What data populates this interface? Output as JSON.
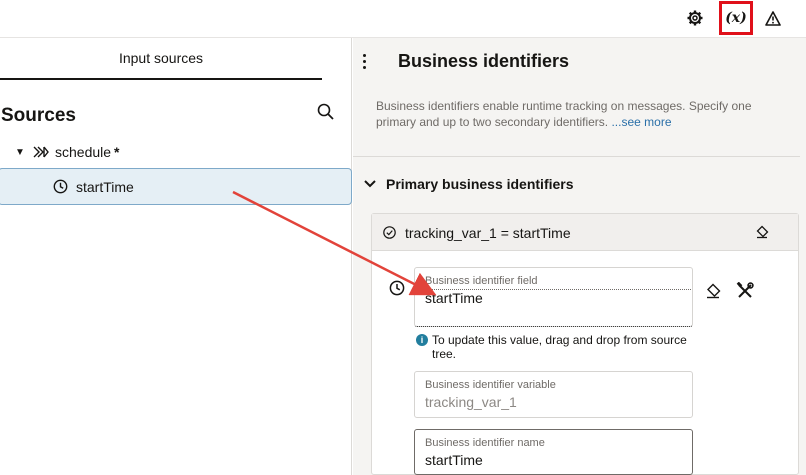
{
  "toolbar": {
    "variables_glyph": "(x)",
    "icons": [
      "gear-icon",
      "variables-icon",
      "warning-icon"
    ],
    "highlight_color": "#e0101a"
  },
  "left_panel": {
    "tab_label": "Input sources",
    "title": "Sources",
    "tree": {
      "root": {
        "label": "schedule",
        "modifier": "*"
      },
      "child": {
        "label": "startTime"
      }
    }
  },
  "right_panel": {
    "title": "Business identifiers",
    "description": "Business identifiers enable runtime tracking on messages. Specify one primary and up to two secondary identifiers.",
    "see_more": "...see more",
    "section_title": "Primary business identifiers",
    "card": {
      "header_label": "tracking_var_1 = startTime",
      "field1": {
        "label": "Business identifier field",
        "value": "startTime"
      },
      "info_text": "To update this value, drag and drop from source tree.",
      "info_badge": "i",
      "field2": {
        "label": "Business identifier variable",
        "value": "tracking_var_1"
      },
      "field3": {
        "label": "Business identifier name",
        "value": "startTime"
      }
    }
  },
  "colors": {
    "selected_row_bg": "#e5eff5",
    "link": "#2a6fa8",
    "arrow": "#e2433a"
  }
}
